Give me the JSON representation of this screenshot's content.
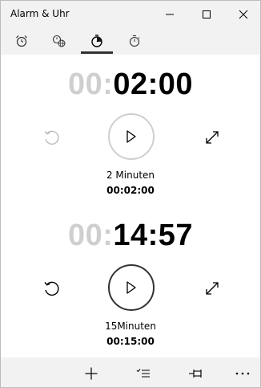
{
  "window": {
    "title": "Alarm & Uhr"
  },
  "tabs": [
    {
      "name": "alarm",
      "icon": "alarm-clock-icon",
      "selected": false
    },
    {
      "name": "world-clock",
      "icon": "world-clock-icon",
      "selected": false
    },
    {
      "name": "timer",
      "icon": "timer-icon",
      "selected": true
    },
    {
      "name": "stopwatch",
      "icon": "stopwatch-icon",
      "selected": false
    }
  ],
  "timers": [
    {
      "hours": "00:",
      "minutes_seconds": "02:00",
      "name": "2 Minuten",
      "duration": "00:02:00",
      "progress_ring": "inactive"
    },
    {
      "hours": "00:",
      "minutes_seconds": "14:57",
      "name": "15Minuten",
      "duration": "00:15:00",
      "progress_ring": "active"
    }
  ],
  "bottombar": {
    "icons": [
      "add-icon",
      "select-list-icon",
      "pin-icon",
      "more-icon"
    ]
  },
  "colors": {
    "chrome_background": "#f2f2f2",
    "inactive_hours": "#cfcfcf",
    "text": "#000000",
    "ring_inactive": "#cfcfcf",
    "ring_active": "#333333"
  }
}
